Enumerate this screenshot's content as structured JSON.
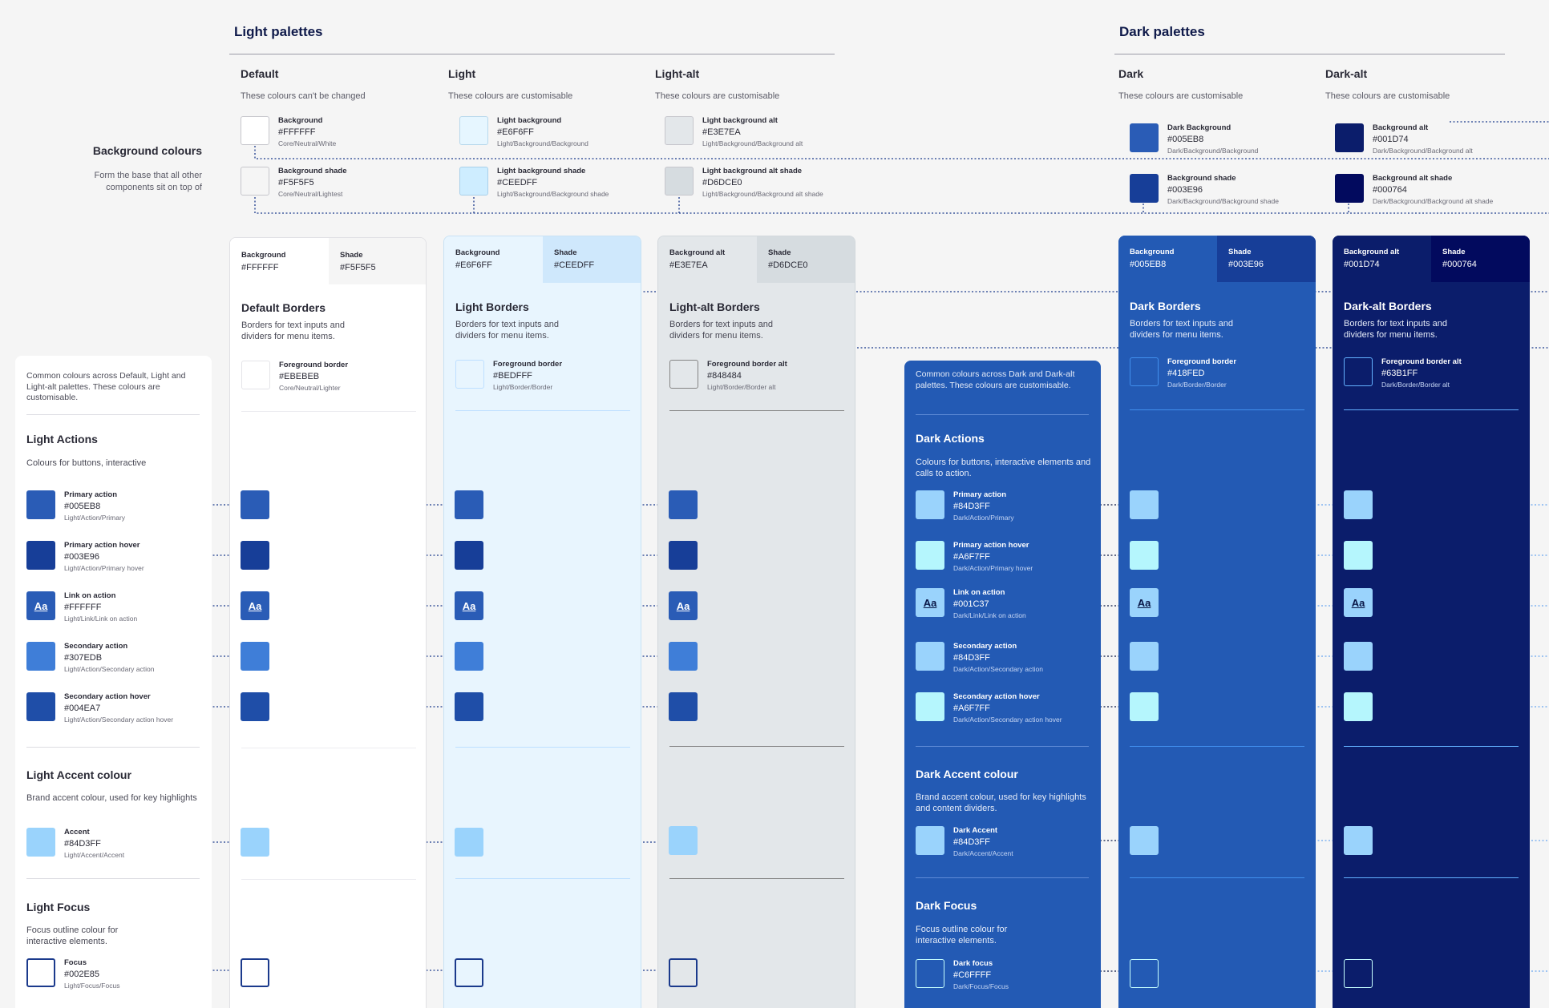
{
  "headings": {
    "light": "Light palettes",
    "dark": "Dark palettes"
  },
  "columns": {
    "default": {
      "title": "Default",
      "subtitle": "These colours can't be changed"
    },
    "light": {
      "title": "Light",
      "subtitle": "These colours are customisable"
    },
    "light_alt": {
      "title": "Light-alt",
      "subtitle": "These colours are customisable"
    },
    "dark": {
      "title": "Dark",
      "subtitle": "These colours are customisable"
    },
    "dark_alt": {
      "title": "Dark-alt",
      "subtitle": "These colours are customisable"
    }
  },
  "bg_section": {
    "title": "Background colours",
    "desc": "Form the base that all other components sit on top of"
  },
  "bg_swatches": {
    "default": [
      {
        "name": "Background",
        "hex": "#FFFFFF",
        "token": "Core/Neutral/White"
      },
      {
        "name": "Background shade",
        "hex": "#F5F5F5",
        "token": "Core/Neutral/Lightest"
      }
    ],
    "light": [
      {
        "name": "Light background",
        "hex": "#E6F6FF",
        "token": "Light/Background/Background"
      },
      {
        "name": "Light background shade",
        "hex": "#CEEDFF",
        "token": "Light/Background/Background shade"
      }
    ],
    "light_alt": [
      {
        "name": "Light background alt",
        "hex": "#E3E7EA",
        "token": "Light/Background/Background alt"
      },
      {
        "name": "Light background alt shade",
        "hex": "#D6DCE0",
        "token": "Light/Background/Background alt shade"
      }
    ],
    "dark": [
      {
        "name": "Dark Background",
        "hex": "#005EB8",
        "token": "Dark/Background/Background"
      },
      {
        "name": "Background shade",
        "hex": "#003E96",
        "token": "Dark/Background/Background shade"
      }
    ],
    "dark_alt": [
      {
        "name": "Background alt",
        "hex": "#001D74",
        "token": "Dark/Background/Background alt"
      },
      {
        "name": "Background alt shade",
        "hex": "#000764",
        "token": "Dark/Background/Background alt shade"
      }
    ]
  },
  "panels": {
    "default": {
      "tab1_label": "Background",
      "tab1_hex": "#FFFFFF",
      "tab2_label": "Shade",
      "tab2_hex": "#F5F5F5",
      "borders_title": "Default Borders",
      "borders_desc": "Borders for text inputs and dividers for menu items.",
      "border_name": "Foreground border",
      "border_hex": "#EBEBEB",
      "border_token": "Core/Neutral/Lighter"
    },
    "light": {
      "tab1_label": "Background",
      "tab1_hex": "#E6F6FF",
      "tab2_label": "Shade",
      "tab2_hex": "#CEEDFF",
      "borders_title": "Light Borders",
      "borders_desc": "Borders for text inputs and dividers for menu items.",
      "border_name": "Foreground border",
      "border_hex": "#BEDFFF",
      "border_token": "Light/Border/Border"
    },
    "light_alt": {
      "tab1_label": "Background alt",
      "tab1_hex": "#E3E7EA",
      "tab2_label": "Shade",
      "tab2_hex": "#D6DCE0",
      "borders_title": "Light-alt Borders",
      "borders_desc": "Borders for text inputs and dividers for menu items.",
      "border_name": "Foreground border alt",
      "border_hex": "#848484",
      "border_token": "Light/Border/Border alt"
    },
    "dark": {
      "tab1_label": "Background",
      "tab1_hex": "#005EB8",
      "tab2_label": "Shade",
      "tab2_hex": "#003E96",
      "borders_title": "Dark Borders",
      "borders_desc": "Borders for text inputs and dividers for menu items.",
      "border_name": "Foreground border",
      "border_hex": "#418FED",
      "border_token": "Dark/Border/Border"
    },
    "dark_alt": {
      "tab1_label": "Background alt",
      "tab1_hex": "#001D74",
      "tab2_label": "Shade",
      "tab2_hex": "#000764",
      "borders_title": "Dark-alt Borders",
      "borders_desc": "Borders for text inputs and dividers for menu items.",
      "border_name": "Foreground border alt",
      "border_hex": "#63B1FF",
      "border_token": "Dark/Border/Border alt"
    }
  },
  "light_common": {
    "intro": "Common colours across Default, Light and Light-alt palettes. These colours are customisable.",
    "actions_title": "Light Actions",
    "actions_desc": "Colours for buttons, interactive",
    "actions": [
      {
        "name": "Primary action",
        "hex": "#005EB8",
        "token": "Light/Action/Primary"
      },
      {
        "name": "Primary action hover",
        "hex": "#003E96",
        "token": "Light/Action/Primary hover"
      },
      {
        "name": "Link on action",
        "hex": "#FFFFFF",
        "token": "Light/Link/Link on action",
        "glyph": "Aa"
      },
      {
        "name": "Secondary action",
        "hex": "#307EDB",
        "token": "Light/Action/Secondary action"
      },
      {
        "name": "Secondary action hover",
        "hex": "#004EA7",
        "token": "Light/Action/Secondary action hover"
      }
    ],
    "accent_title": "Light Accent colour",
    "accent_desc": "Brand accent colour, used for key highlights",
    "accent": {
      "name": "Accent",
      "hex": "#84D3FF",
      "token": "Light/Accent/Accent"
    },
    "focus_title": "Light Focus",
    "focus_desc": "Focus outline colour for interactive elements.",
    "focus": {
      "name": "Focus",
      "hex": "#002E85",
      "token": "Light/Focus/Focus"
    }
  },
  "dark_common": {
    "intro": "Common colours across Dark and Dark-alt palettes. These colours are customisable.",
    "actions_title": "Dark Actions",
    "actions_desc": "Colours for buttons, interactive elements and calls to action.",
    "actions": [
      {
        "name": "Primary action",
        "hex": "#84D3FF",
        "token": "Dark/Action/Primary"
      },
      {
        "name": "Primary action hover",
        "hex": "#A6F7FF",
        "token": "Dark/Action/Primary hover"
      },
      {
        "name": "Link on action",
        "hex": "#001C37",
        "token": "Dark/Link/Link on action",
        "glyph": "Aa"
      },
      {
        "name": "Secondary action",
        "hex": "#84D3FF",
        "token": "Dark/Action/Secondary action"
      },
      {
        "name": "Secondary action hover",
        "hex": "#A6F7FF",
        "token": "Dark/Action/Secondary action hover"
      }
    ],
    "accent_title": "Dark Accent colour",
    "accent_desc": "Brand accent colour, used for key highlights and content dividers.",
    "accent": {
      "name": "Dark Accent",
      "hex": "#84D3FF",
      "token": "Dark/Accent/Accent"
    },
    "focus_title": "Dark Focus",
    "focus_desc": "Focus outline colour for interactive elements.",
    "focus": {
      "name": "Dark focus",
      "hex": "#C6FFFF",
      "token": "Dark/Focus/Focus"
    }
  },
  "colors": {
    "connector": "#1b3a8c",
    "panel_default": "#ffffff",
    "panel_light": "#e8f5fe",
    "panel_light_alt": "#e3e7ea",
    "panel_dark": "#235ab4",
    "panel_dark_alt": "#0b1d6b"
  }
}
